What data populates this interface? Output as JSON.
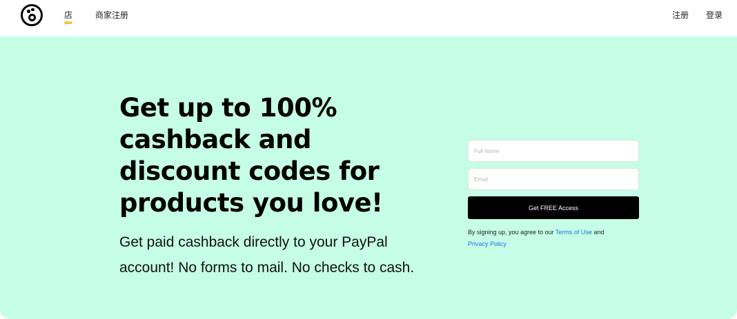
{
  "header": {
    "logo": "logo-icon",
    "nav": {
      "store": "店",
      "merchant_signup": "商家注册"
    },
    "auth": {
      "signup": "注册",
      "login": "登录"
    },
    "active_indicator_color": "#f4c542"
  },
  "hero": {
    "background_color": "#c5fde6",
    "headline": "Get up to 100% cashback and discount codes for products you love!",
    "subtext": "Get paid cashback directly to your PayPal account! No forms to mail. No checks to cash."
  },
  "form": {
    "full_name_placeholder": "Full Name",
    "email_placeholder": "Email",
    "full_name_value": "",
    "email_value": "",
    "submit_label": "Get FREE Access",
    "legal": {
      "prefix": "By signing up, you agree to our ",
      "terms_link": "Terms of Use",
      "middle": " and",
      "privacy_link": "Privacy Policy"
    },
    "link_color": "#1a73e8"
  }
}
